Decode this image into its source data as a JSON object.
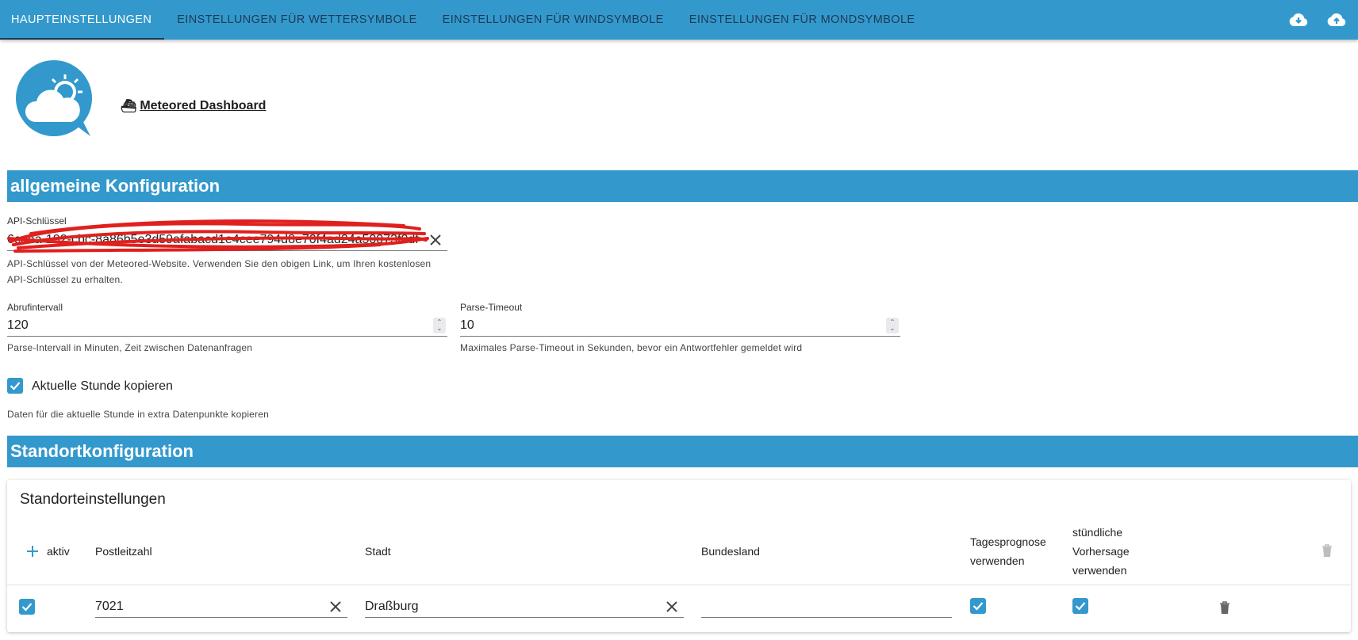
{
  "tabs": [
    {
      "label": "Haupteinstellungen",
      "active": true
    },
    {
      "label": "Einstellungen für Wettersymbole",
      "active": false
    },
    {
      "label": "Einstellungen für Windsymbole",
      "active": false
    },
    {
      "label": "Einstellungen für Mondsymbole",
      "active": false
    }
  ],
  "toolbar_icons": [
    "cloud-download-icon",
    "cloud-upload-icon"
  ],
  "header": {
    "logo_icon": "meteored-logo",
    "link_emoji": "⛴",
    "link_text": "Meteored Dashboard"
  },
  "general": {
    "title": "allgemeine Konfiguration",
    "api_key": {
      "label": "API-Schlüssel",
      "value": "6ceea-192-cbc-8a86b5e3d59afabacd1e4cee794d8e70f4ad24a50073f0df",
      "help_line1": "API-Schlüssel von der Meteored-Website. Verwenden Sie den obigen Link, um Ihren kostenlosen",
      "help_line2": "API-Schlüssel zu erhalten."
    },
    "interval": {
      "label": "Abrufintervall",
      "value": "120",
      "help": "Parse-Intervall in Minuten, Zeit zwischen Datenanfragen"
    },
    "timeout": {
      "label": "Parse-Timeout",
      "value": "10",
      "help": "Maximales Parse-Timeout in Sekunden, bevor ein Antwortfehler gemeldet wird"
    },
    "copy_hour": {
      "label": "Aktuelle Stunde kopieren",
      "checked": true,
      "help": "Daten für die aktuelle Stunde in extra Datenpunkte kopieren"
    }
  },
  "location": {
    "title": "Standortkonfiguration",
    "card_title": "Standorteinstellungen",
    "columns": {
      "active": "aktiv",
      "zip": "Postleitzahl",
      "city": "Stadt",
      "state": "Bundesland",
      "daily_1": "Tagesprognose",
      "daily_2": "verwenden",
      "hourly_1": "stündliche",
      "hourly_2": "Vorhersage",
      "hourly_3": "verwenden"
    },
    "rows": [
      {
        "active": true,
        "zip": "7021",
        "city": "Draßburg",
        "state": "",
        "daily": true,
        "hourly": true
      }
    ]
  },
  "colors": {
    "primary": "#3399cc",
    "tab_text": "#1e3a55",
    "scribble": "#e0201e"
  }
}
